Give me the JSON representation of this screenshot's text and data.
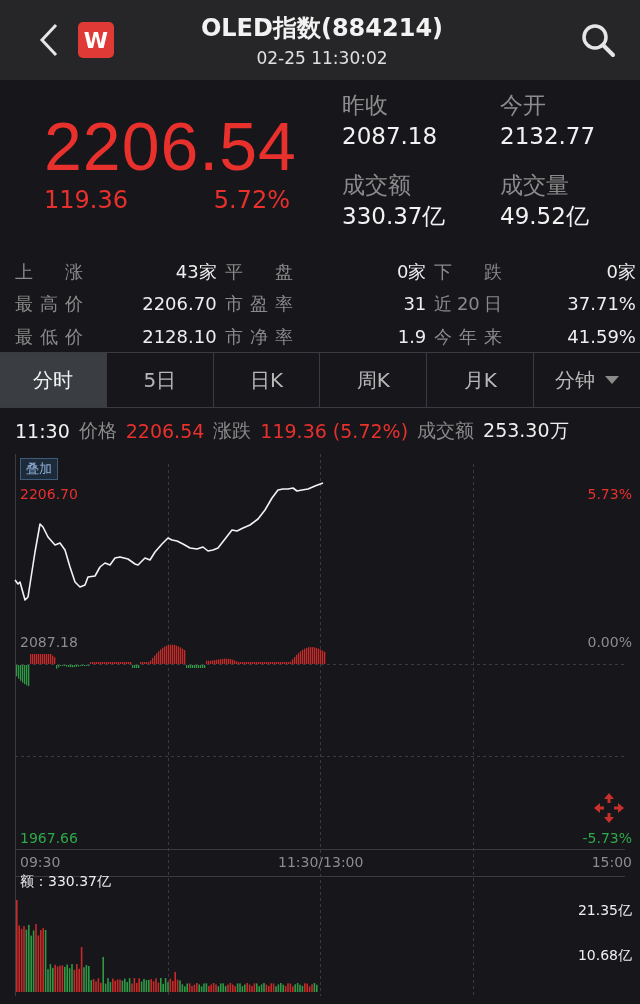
{
  "header": {
    "title": "OLED指数(884214)",
    "subtitle": "02-25 11:30:02",
    "badge": "W"
  },
  "quote": {
    "price": "2206.54",
    "change": "119.36",
    "change_pct": "5.72%",
    "fields": [
      {
        "label": "昨收",
        "value": "2087.18"
      },
      {
        "label": "今开",
        "value": "2132.77"
      },
      {
        "label": "成交额",
        "value": "330.37亿"
      },
      {
        "label": "成交量",
        "value": "49.52亿"
      }
    ]
  },
  "stats": [
    [
      {
        "label": "上 涨",
        "value": "43家"
      },
      {
        "label": "平 盘",
        "value": "0家"
      },
      {
        "label": "下 跌",
        "value": "0家"
      }
    ],
    [
      {
        "label": "最高价",
        "value": "2206.70"
      },
      {
        "label": "市盈率",
        "value": "31"
      },
      {
        "label": "近20日",
        "value": "37.71%"
      }
    ],
    [
      {
        "label": "最低价",
        "value": "2128.10"
      },
      {
        "label": "市净率",
        "value": "1.9"
      },
      {
        "label": "今年来",
        "value": "41.59%"
      }
    ]
  ],
  "tabs": [
    {
      "label": "分时",
      "selected": true,
      "dropdown": false
    },
    {
      "label": "5日",
      "selected": false,
      "dropdown": false
    },
    {
      "label": "日K",
      "selected": false,
      "dropdown": false
    },
    {
      "label": "周K",
      "selected": false,
      "dropdown": false
    },
    {
      "label": "月K",
      "selected": false,
      "dropdown": false
    },
    {
      "label": "分钟",
      "selected": false,
      "dropdown": true
    }
  ],
  "info_line": {
    "time": "11:30",
    "items": [
      {
        "label": "价格",
        "value": "2206.54",
        "kind": "up"
      },
      {
        "label": "涨跌",
        "value": "119.36 (5.72%)",
        "kind": "up"
      },
      {
        "label": "成交额",
        "value": "253.30万",
        "kind": "plain"
      }
    ]
  },
  "chart": {
    "overlay_button": "叠加",
    "left_labels": [
      {
        "text": "2206.70",
        "kind": "up"
      },
      {
        "text": "2087.18",
        "kind": "plain"
      },
      {
        "text": "1967.66",
        "kind": "down"
      }
    ],
    "right_labels": [
      {
        "text": "5.73%",
        "kind": "up"
      },
      {
        "text": "0.00%",
        "kind": "plain"
      },
      {
        "text": "-5.73%",
        "kind": "down"
      }
    ],
    "time_axis": [
      "09:30",
      "11:30/13:00",
      "15:00"
    ],
    "volume_label": "额：330.37亿",
    "volume_ticks": [
      "21.35亿",
      "10.68亿"
    ]
  }
}
